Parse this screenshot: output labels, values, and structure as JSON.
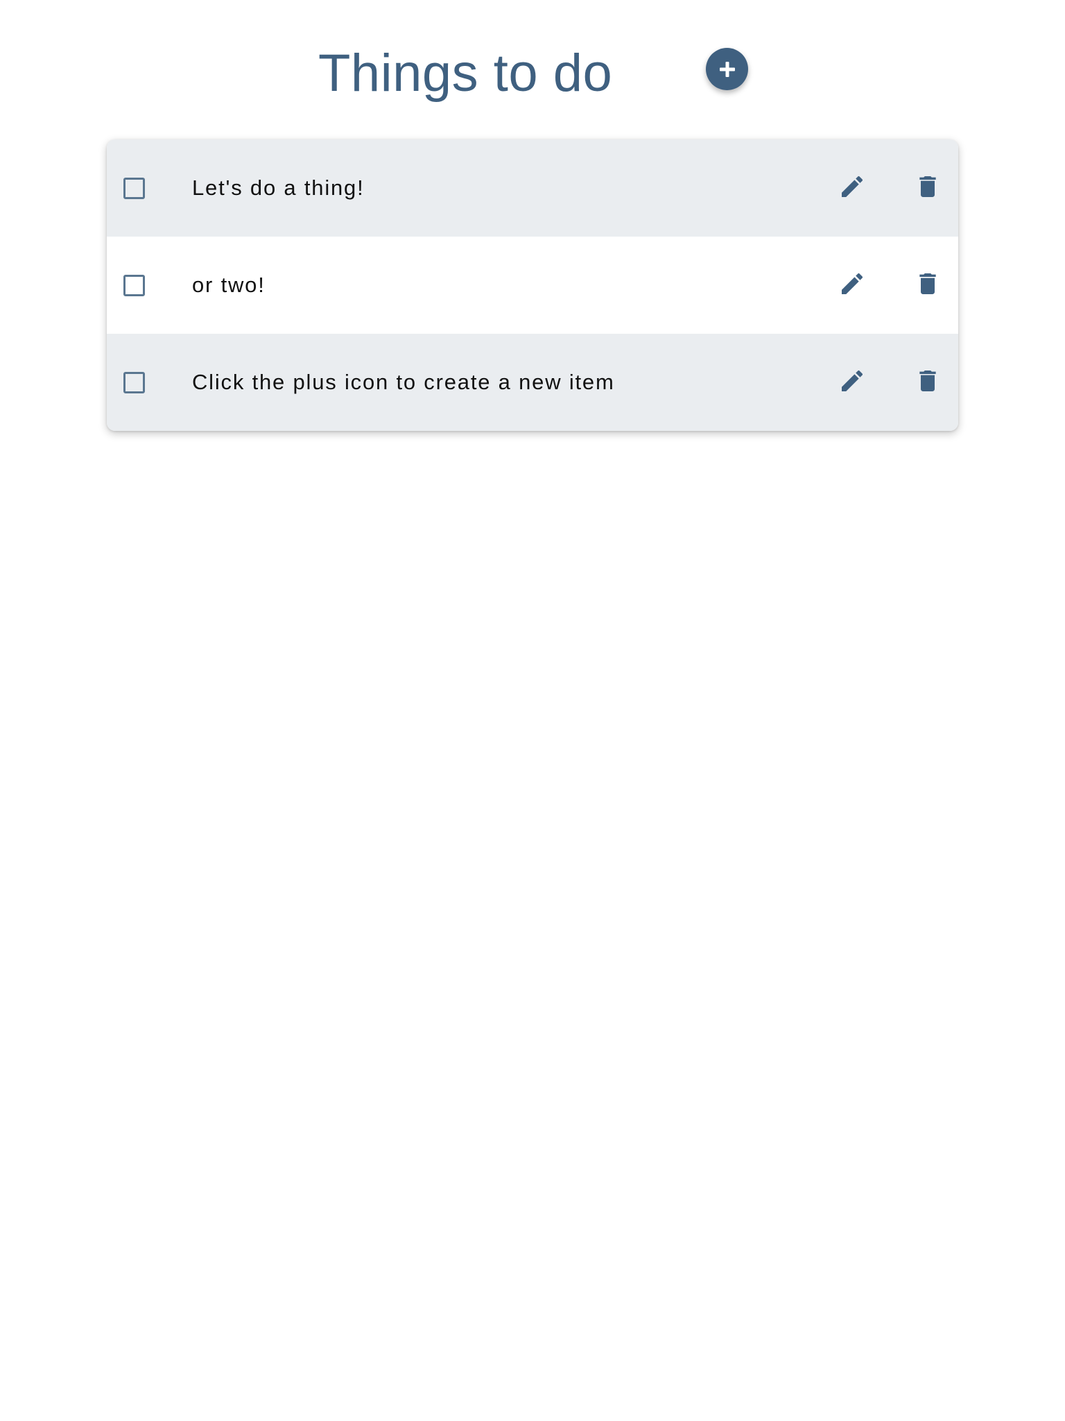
{
  "header": {
    "title": "Things to do",
    "add_button_icon": "plus-icon"
  },
  "todos": [
    {
      "text": "Let's do a thing!",
      "checked": false,
      "edit_icon": "pencil-icon",
      "delete_icon": "trash-icon"
    },
    {
      "text": "or two!",
      "checked": false,
      "edit_icon": "pencil-icon",
      "delete_icon": "trash-icon"
    },
    {
      "text": "Click the plus icon to create a new item",
      "checked": false,
      "edit_icon": "pencil-icon",
      "delete_icon": "trash-icon"
    }
  ],
  "colors": {
    "accent": "#3f6080",
    "row_shade": "#eaedf0",
    "checkbox_border": "#5a7690",
    "text": "#111111"
  }
}
